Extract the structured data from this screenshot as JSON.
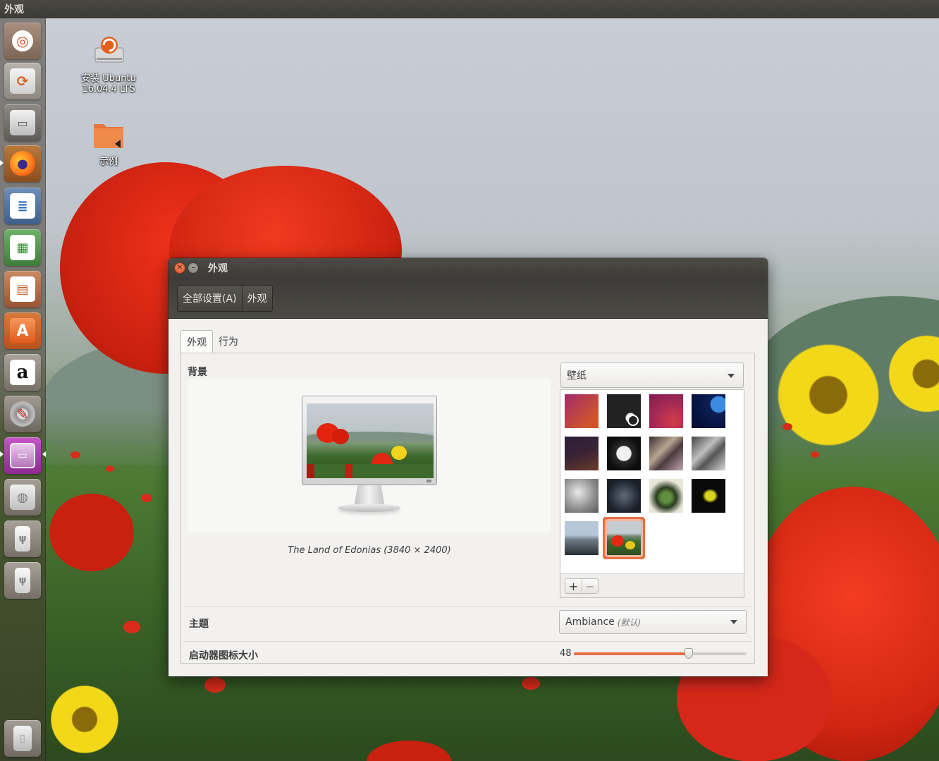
{
  "top_panel": {
    "title": "外观"
  },
  "launcher": {
    "items": [
      {
        "name": "ubuntu-dash"
      },
      {
        "name": "install-ubuntu"
      },
      {
        "name": "files"
      },
      {
        "name": "firefox"
      },
      {
        "name": "libreoffice-writer"
      },
      {
        "name": "libreoffice-calc"
      },
      {
        "name": "libreoffice-impress"
      },
      {
        "name": "ubuntu-software"
      },
      {
        "name": "amazon"
      },
      {
        "name": "system-settings"
      },
      {
        "name": "appearance"
      },
      {
        "name": "drive"
      },
      {
        "name": "usb-1"
      },
      {
        "name": "usb-2"
      },
      {
        "name": "trash"
      }
    ]
  },
  "desktop": {
    "icons": [
      {
        "label_line1": "安装 Ubuntu",
        "label_line2": "16.04.4 LTS"
      },
      {
        "label_line1": "示例"
      }
    ]
  },
  "window": {
    "title": "外观",
    "breadcrumb": [
      "全部设置(A)",
      "外观"
    ],
    "tabs": [
      "外观",
      "行为"
    ],
    "background_label": "背景",
    "wallpaper_caption": "The Land of Edonias (3840 × 2400)",
    "source_combo": "壁纸",
    "add_label": "+",
    "remove_label": "−",
    "theme_label": "主题",
    "theme_value": "Ambiance",
    "theme_default": "(默认)",
    "icon_size_label": "启动器图标大小",
    "icon_size_value": "48",
    "icon_size_min": 16,
    "icon_size_max": 64,
    "accent": "#e86f43"
  }
}
